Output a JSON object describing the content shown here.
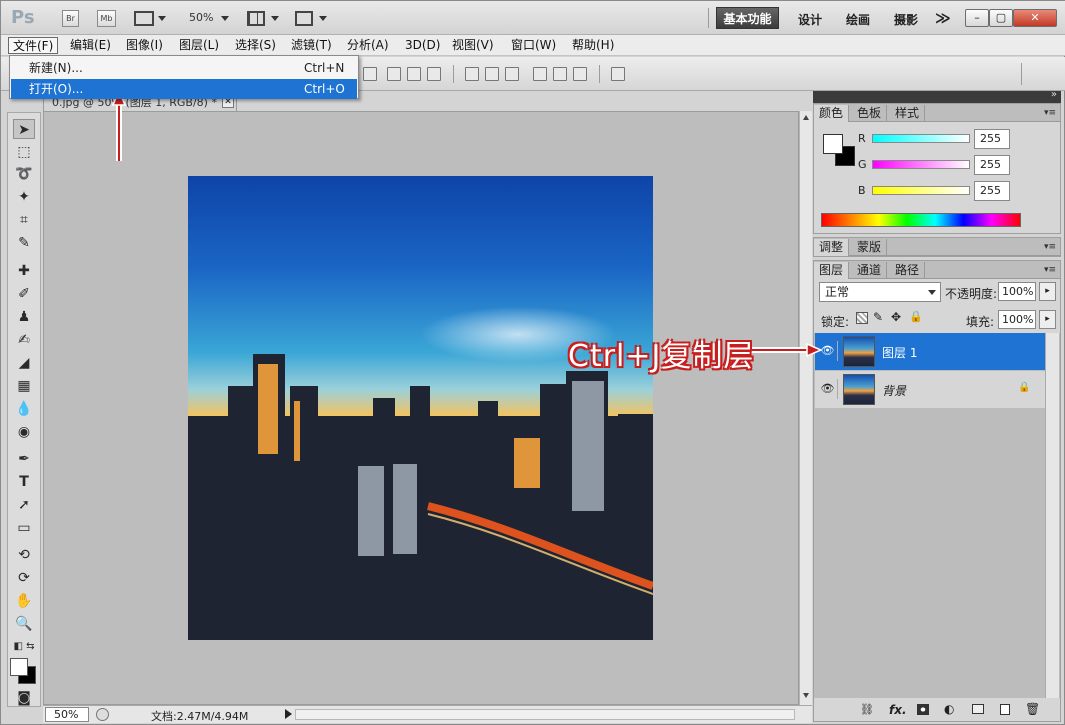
{
  "app": {
    "logo": "Ps",
    "bridge_label": "Br",
    "minibridge_label": "Mb",
    "zoom": "50%",
    "workspaces": [
      "基本功能",
      "设计",
      "绘画",
      "摄影"
    ],
    "more_workspaces": "≫"
  },
  "window_controls": {
    "minimize": "–",
    "restore": "▢",
    "close": "✕"
  },
  "menubar": [
    "文件(F)",
    "编辑(E)",
    "图像(I)",
    "图层(L)",
    "选择(S)",
    "滤镜(T)",
    "分析(A)",
    "3D(D)",
    "视图(V)",
    "窗口(W)",
    "帮助(H)"
  ],
  "file_menu": [
    {
      "label": "新建(N)...",
      "shortcut": "Ctrl+N"
    },
    {
      "label": "打开(O)...",
      "shortcut": "Ctrl+O",
      "highlighted": true
    }
  ],
  "document": {
    "tab_title": "0.jpg @ 50% (图层 1, RGB/8) *",
    "tab_close": "✕",
    "zoom": "50%",
    "info": "文档:2.47M/4.94M"
  },
  "color_panel": {
    "tabs": [
      "颜色",
      "色板",
      "样式"
    ],
    "channels": [
      {
        "name": "R",
        "value": "255",
        "gradient": "#20d0d0"
      },
      {
        "name": "G",
        "value": "255",
        "gradient": "#e020e0"
      },
      {
        "name": "B",
        "value": "255",
        "gradient": "#f0f020"
      }
    ]
  },
  "adjust_panel": {
    "tabs": [
      "调整",
      "蒙版"
    ]
  },
  "layers_panel": {
    "tabs": [
      "图层",
      "通道",
      "路径"
    ],
    "blend_mode": "正常",
    "opacity_label": "不透明度:",
    "opacity": "100%",
    "lock_label": "锁定:",
    "fill_label": "填充:",
    "fill": "100%",
    "layers": [
      {
        "name": "图层 1",
        "selected": true,
        "locked": false
      },
      {
        "name": "背景",
        "selected": false,
        "locked": true
      }
    ],
    "footer_icons": [
      "link-icon",
      "fx-icon",
      "mask-icon",
      "adjustment-icon",
      "group-icon",
      "new-layer-icon",
      "trash-icon"
    ],
    "fx_label": "fx."
  },
  "annotation": "Ctrl+J复制层",
  "colors": {
    "menu_highlight": "#1f74d3",
    "layer_selected": "#1f74d3",
    "annotation_stroke": "#c81e1e",
    "arrow": "#c81e1e"
  }
}
